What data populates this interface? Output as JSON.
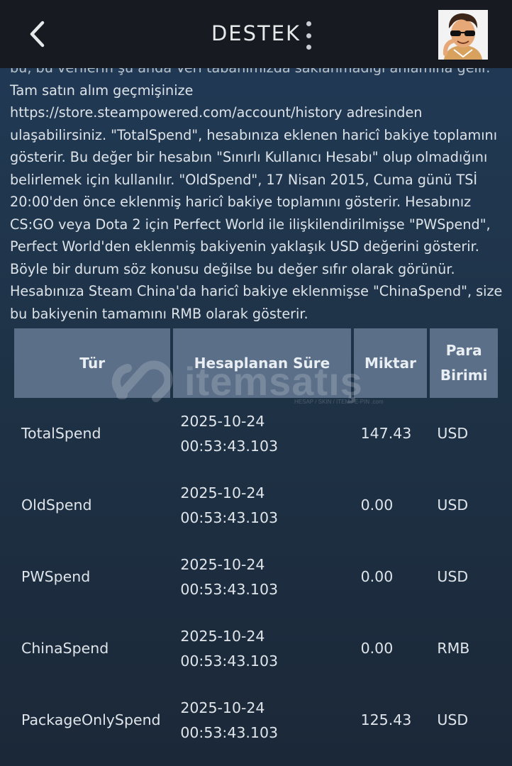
{
  "header": {
    "title": "DESTEK",
    "back_icon": "chevron-left-icon",
    "menu_icon": "more-vertical-icon",
    "avatar": "user-avatar"
  },
  "info": {
    "clipped_line": "bu, bu verilerin şu anda Veri tabanımızda saklanmadığı anlamına gelir.",
    "text": "Tam satın alım geçmişinize https://store.steampowered.com/account/history adresinden ulaşabilirsiniz. \"TotalSpend\", hesabınıza eklenen haricî bakiye toplamını gösterir. Bu değer bir hesabın \"Sınırlı Kullanıcı Hesabı\" olup olmadığını belirlemek için kullanılır. \"OldSpend\", 17 Nisan 2015, Cuma günü TSİ 20:00'den önce eklenmiş haricî bakiye toplamını gösterir. Hesabınız CS:GO veya Dota 2 için Perfect World ile ilişkilendirilmişse \"PWSpend\", Perfect World'den eklenmiş bakiyenin yaklaşık USD değerini gösterir. Böyle bir durum söz konusu değilse bu değer sıfır olarak görünür. Hesabınıza Steam China'da haricî bakiye eklenmişse \"ChinaSpend\", size bu bakiyenin tamamını RMB olarak gösterir."
  },
  "table": {
    "headers": [
      "Tür",
      "Hesaplanan Süre",
      "Miktar",
      "Para Birimi"
    ],
    "rows": [
      {
        "type": "TotalSpend",
        "date": "2025-10-24",
        "time": "00:53:43.103",
        "amount": "147.43",
        "currency": "USD"
      },
      {
        "type": "OldSpend",
        "date": "2025-10-24",
        "time": "00:53:43.103",
        "amount": "0.00",
        "currency": "USD"
      },
      {
        "type": "PWSpend",
        "date": "2025-10-24",
        "time": "00:53:43.103",
        "amount": "0.00",
        "currency": "USD"
      },
      {
        "type": "ChinaSpend",
        "date": "2025-10-24",
        "time": "00:53:43.103",
        "amount": "0.00",
        "currency": "RMB"
      },
      {
        "type": "PackageOnlySpend",
        "date": "2025-10-24",
        "time": "00:53:43.103",
        "amount": "125.43",
        "currency": "USD"
      }
    ]
  },
  "watermark": {
    "text": "itemsatış",
    "sub": "HESAP / SKIN / ITEM / E-PIN .com"
  },
  "colors": {
    "header_bg": "#171a21",
    "page_bg": "#1b2838",
    "table_header_bg": "#5b6f88"
  }
}
